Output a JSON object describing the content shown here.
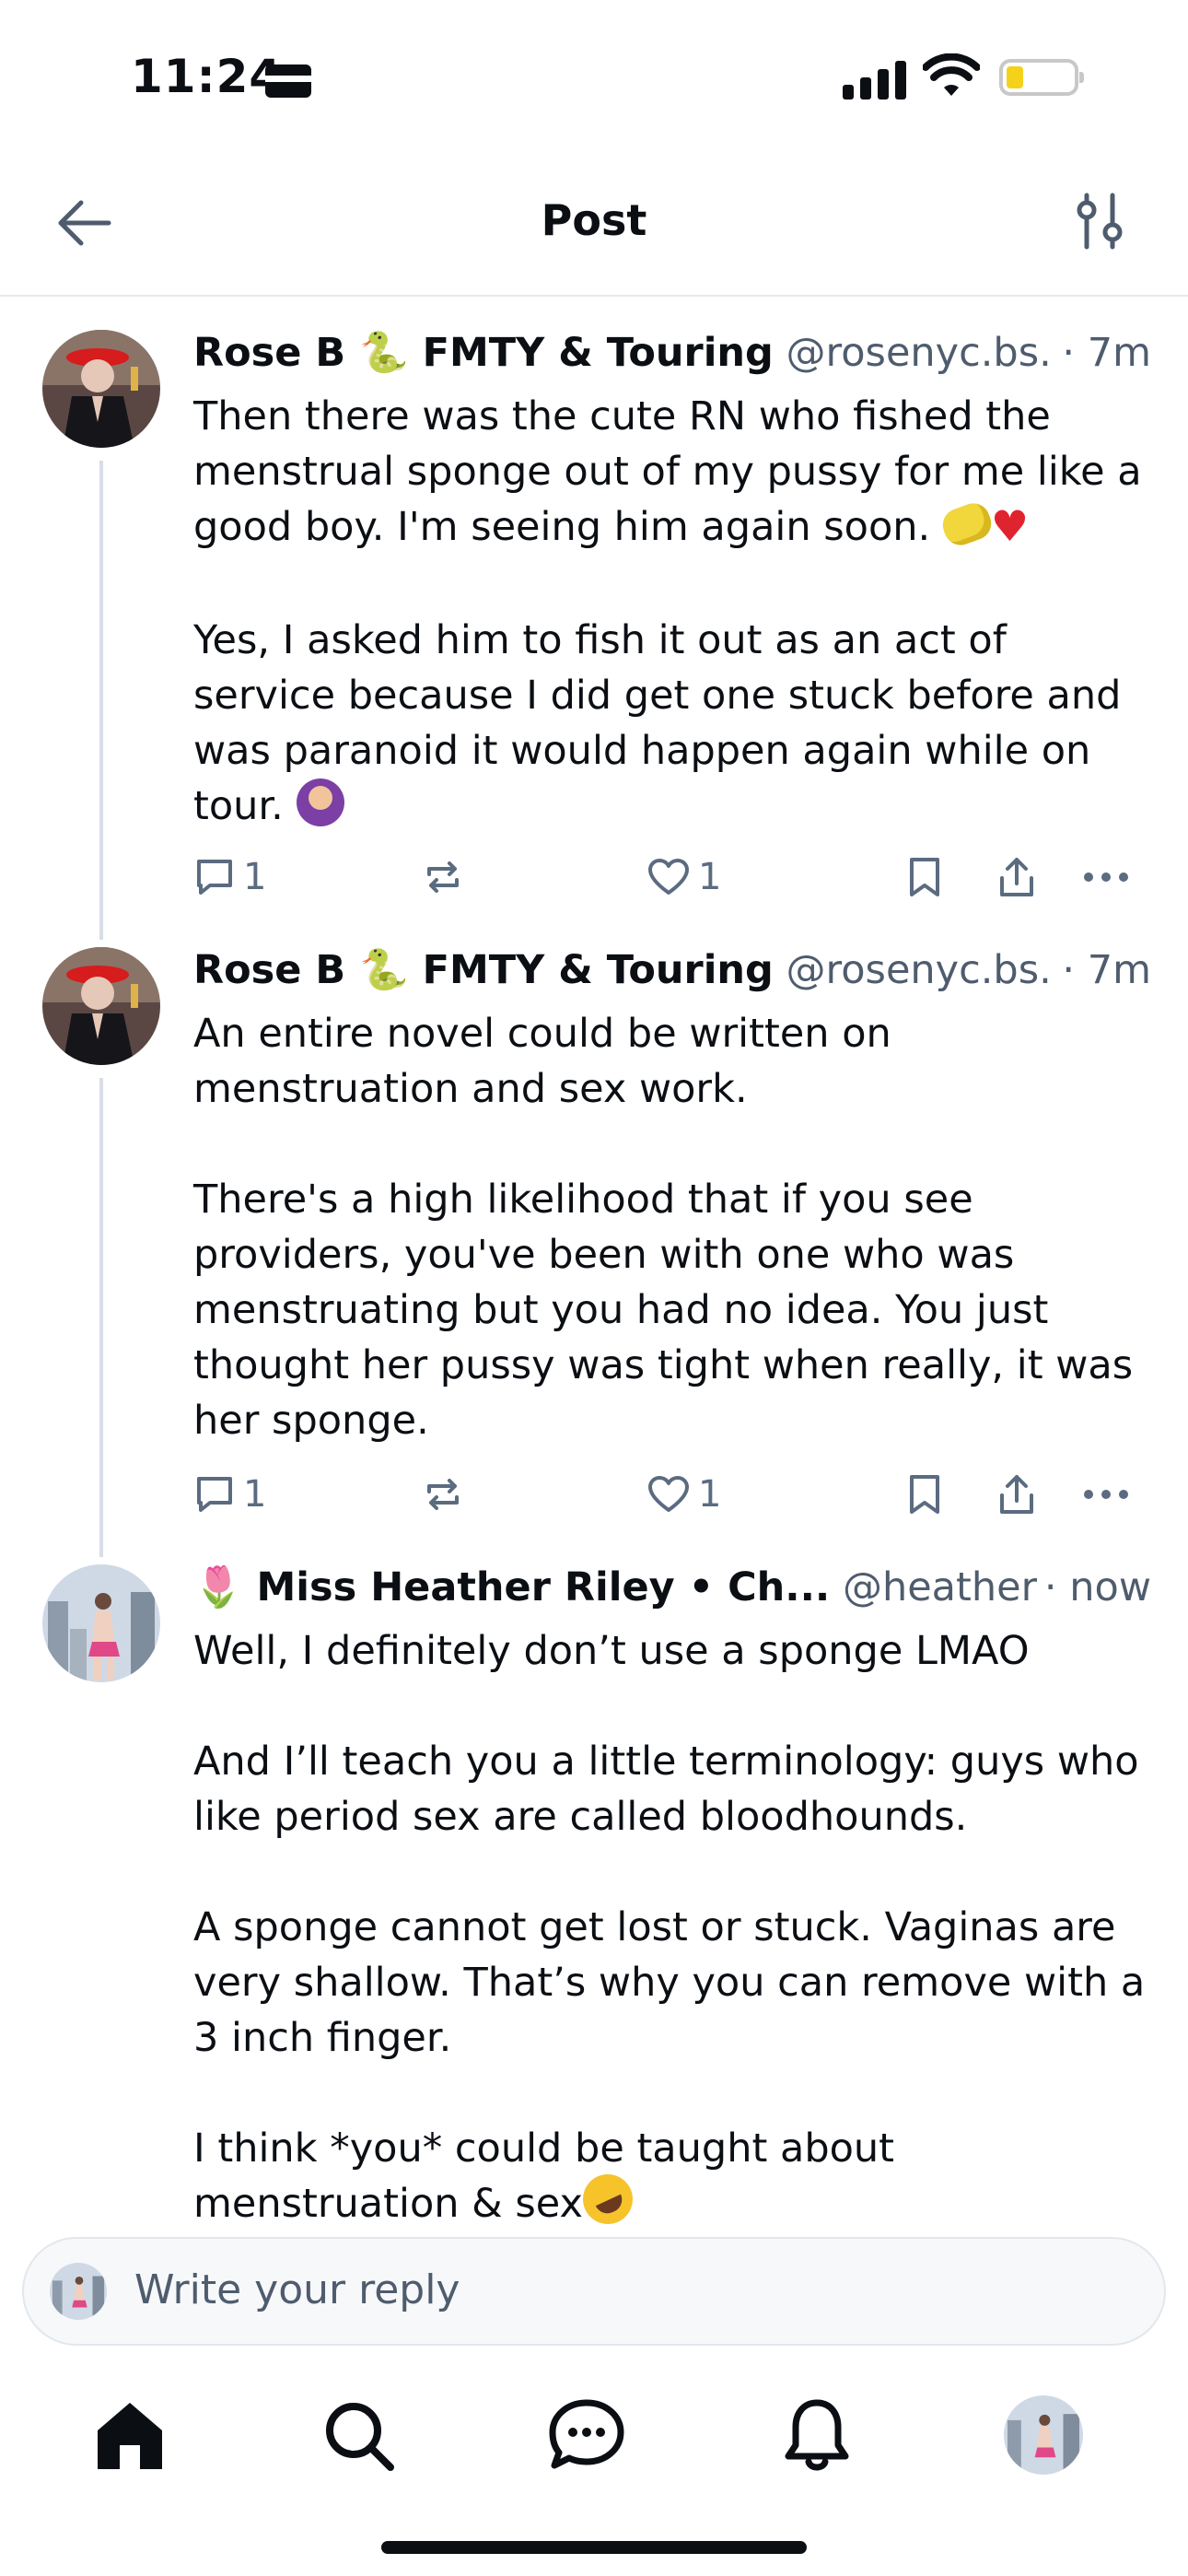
{
  "status_bar": {
    "time": "11:24"
  },
  "header": {
    "title": "Post"
  },
  "posts": [
    {
      "author": "Rose B 🐍 FMTY & Touring",
      "handle": "@rosenyc.bs...",
      "time": "· 7m",
      "paragraphs": [
        "Then there was the cute RN who fished the menstrual sponge out of my pussy for me like a good boy. I'm seeing him again soon.",
        "Yes, I asked him to fish it out as an act of service because I did get one stuck before and was paranoid it would happen again while on tour."
      ],
      "replies": "1",
      "likes": "1"
    },
    {
      "author": "Rose B 🐍 FMTY & Touring",
      "handle": "@rosenyc.bs...",
      "time": "· 7m",
      "paragraphs": [
        "An entire novel could be written on menstruation and sex work.",
        "There's a high likelihood that if you see providers, you've been with one who was menstruating but you had no idea. You just thought her pussy was tight when really, it was her sponge."
      ],
      "replies": "1",
      "likes": "1"
    },
    {
      "author": "🌷 Miss Heather Riley • Ch...",
      "handle": "@heatherr...",
      "time": "· now",
      "paragraphs": [
        "Well, I definitely don’t use a sponge LMAO",
        "And I’ll teach you a little terminology: guys who like period sex are called bloodhounds.",
        "A sponge cannot get lost or stuck. Vaginas are very shallow. That’s why you can remove with a 3 inch finger.",
        "I think *you* could be taught about menstruation & sex"
      ]
    }
  ],
  "reply_box": {
    "placeholder": "Write your reply"
  },
  "tabs": [
    "home-icon",
    "search-icon",
    "chat-icon",
    "bell-icon",
    "profile-avatar"
  ],
  "colors": {
    "text": "#0b0f14",
    "muted": "#4f5c6e",
    "action": "#5b6b80",
    "thread_line": "#d8dde6"
  }
}
